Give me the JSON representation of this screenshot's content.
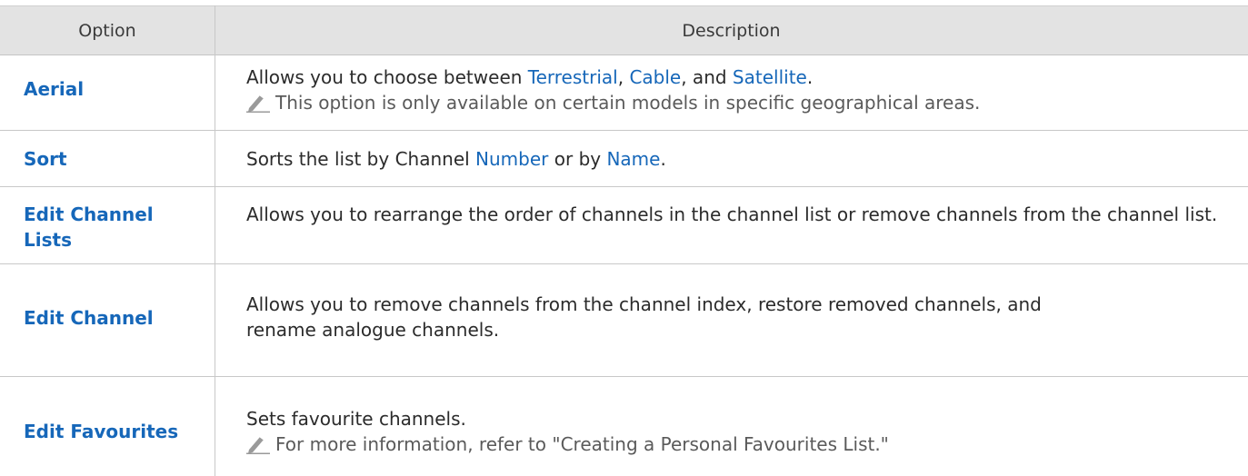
{
  "header": {
    "option": "Option",
    "description": "Description"
  },
  "rows": [
    {
      "option": "Aerial",
      "desc_parts": [
        "Allows you to choose between ",
        "Terrestrial",
        ", ",
        "Cable",
        ", and ",
        "Satellite",
        "."
      ],
      "note": "This option is only available on certain models in specific geographical areas."
    },
    {
      "option": "Sort",
      "desc_parts": [
        "Sorts the list by Channel ",
        "Number",
        " or by ",
        "Name",
        "."
      ]
    },
    {
      "option": "Edit Channel Lists",
      "desc": "Allows you to rearrange the order of channels in the channel list or remove channels from the channel list."
    },
    {
      "option": "Edit Channel",
      "desc": "Allows you to remove channels from the channel index, restore removed channels, and rename analogue channels."
    },
    {
      "option": "Edit Favourites",
      "desc": "Sets favourite channels.",
      "note": "For more information, refer to \"Creating a Personal Favourites List.\""
    }
  ],
  "colors": {
    "link": "#1667b9",
    "header_bg": "#e3e3e3",
    "note_text": "#5a5a5a"
  },
  "icons": {
    "note": "pencil-icon"
  }
}
